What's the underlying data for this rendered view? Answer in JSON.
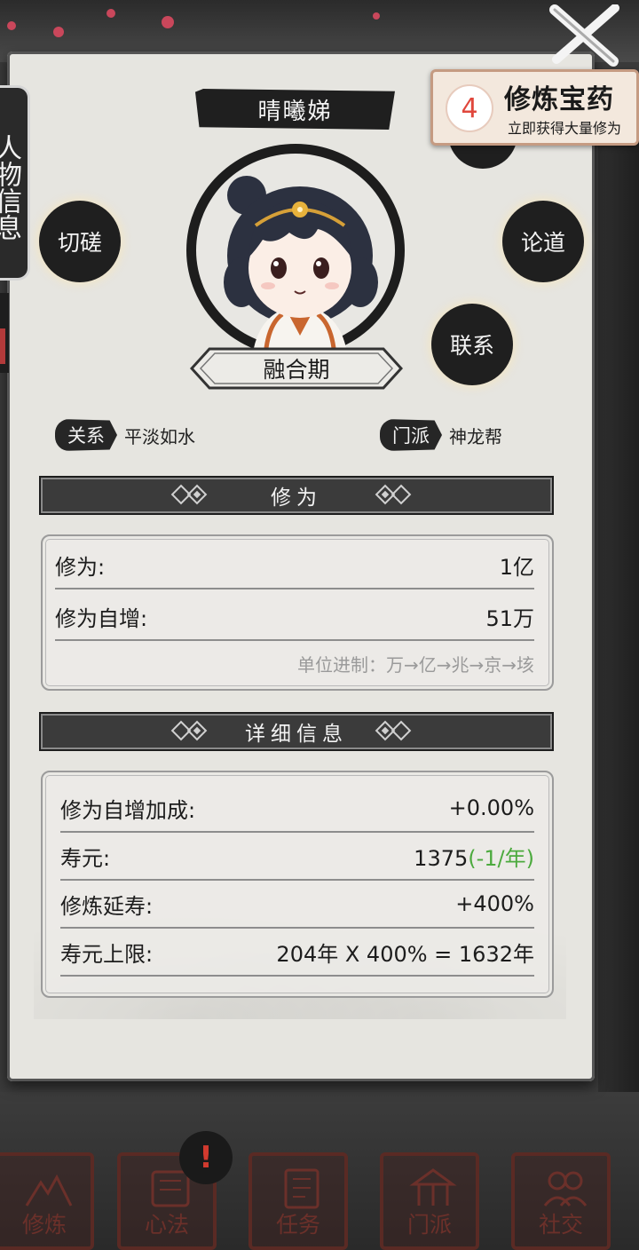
{
  "character": {
    "name": "晴曦娣",
    "realm": "融合期"
  },
  "side_tab_label": "人物信息",
  "actions": {
    "spar": "切磋",
    "discuss": "论道",
    "contact": "联系"
  },
  "promo": {
    "count": "4",
    "title": "修炼宝药",
    "subtitle": "立即获得大量修为"
  },
  "tags": {
    "relation_label": "关系",
    "relation_value": "平淡如水",
    "sect_label": "门派",
    "sect_value": "神龙帮"
  },
  "cultivation_section": {
    "title": "修为",
    "rows": [
      {
        "label": "修为:",
        "value": "1亿"
      },
      {
        "label": "修为自增:",
        "value": "51万"
      }
    ],
    "unit_note": "单位进制：万→亿→兆→京→垓"
  },
  "detail_section": {
    "title": "详细信息",
    "rows": [
      {
        "label": "修为自增加成:",
        "value": "+0.00%"
      },
      {
        "label": "寿元:",
        "value": "1375",
        "extra": "(-1/年)"
      },
      {
        "label": "修炼延寿:",
        "value": "+400%"
      },
      {
        "label": "寿元上限:",
        "value": "204年 X 400% = 1632年"
      }
    ]
  },
  "alert_symbol": "!",
  "bottom_nav": [
    {
      "label": "修炼",
      "icon": "cultivate-icon"
    },
    {
      "label": "心法",
      "icon": "scroll-icon"
    },
    {
      "label": "任务",
      "icon": "task-icon"
    },
    {
      "label": "门派",
      "icon": "sect-icon"
    },
    {
      "label": "社交",
      "icon": "social-icon"
    }
  ],
  "colors": {
    "panel": "#e6e5e0",
    "ink": "#1f1f1f",
    "accent_red": "#e0473c",
    "lifespan_green": "#4caa3e",
    "nav_seal": "#5a2a24"
  }
}
